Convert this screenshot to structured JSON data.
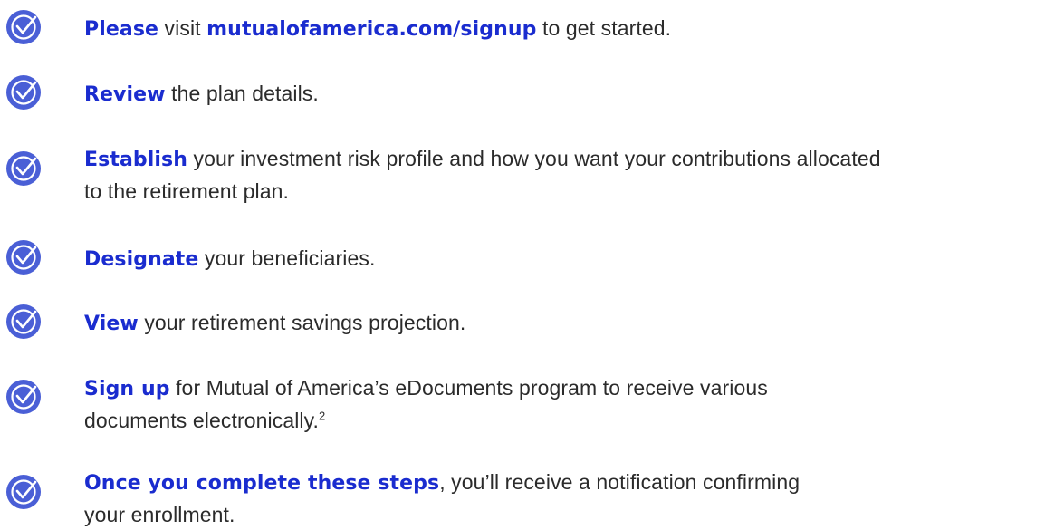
{
  "colors": {
    "accent": "#1a2ccf",
    "icon_fill": "#4a5fd6",
    "icon_stroke": "#ffffff",
    "text": "#2b2b2b"
  },
  "steps": [
    {
      "icon": "checkmark-circle-icon",
      "bold": "Please",
      "mid": " visit ",
      "link": "mutualofamerica.com/signup",
      "rest": " to get started."
    },
    {
      "icon": "checkmark-circle-icon",
      "bold": "Review",
      "rest": " the plan details."
    },
    {
      "icon": "checkmark-circle-icon",
      "bold": "Establish",
      "rest": " your investment risk profile and how you want your contributions allocated",
      "line2": "to the retirement plan."
    },
    {
      "icon": "checkmark-circle-icon",
      "bold": "Designate",
      "rest": " your beneficiaries."
    },
    {
      "icon": "checkmark-circle-icon",
      "bold": "View",
      "rest": " your retirement savings projection."
    },
    {
      "icon": "checkmark-circle-icon",
      "bold": "Sign up",
      "rest": " for Mutual of America’s eDocuments program to receive various",
      "line2": "documents electronically.",
      "footnote": "2"
    },
    {
      "icon": "checkmark-circle-icon",
      "bold": "Once you complete these steps",
      "rest": ", you’ll receive a notification confirming",
      "line2": "your enrollment."
    }
  ]
}
